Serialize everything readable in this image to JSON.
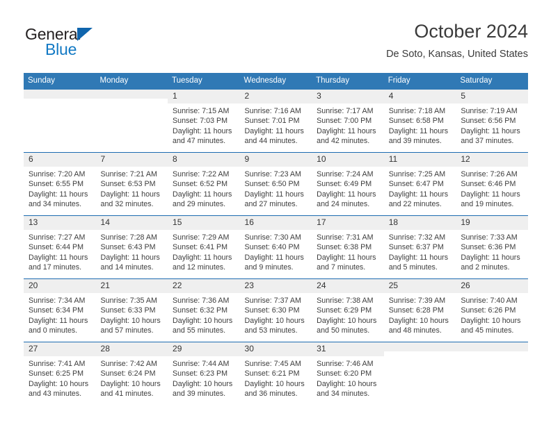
{
  "brand": {
    "name_part1": "General",
    "name_part2": "Blue",
    "triangle_color": "#1065ad",
    "blue_color": "#1279c4"
  },
  "header": {
    "title": "October 2024",
    "subtitle": "De Soto, Kansas, United States"
  },
  "theme": {
    "header_bg": "#3079b5",
    "row_divider": "#1c6bb0",
    "daynum_bg": "#efefef"
  },
  "weekday_headers": [
    "Sunday",
    "Monday",
    "Tuesday",
    "Wednesday",
    "Thursday",
    "Friday",
    "Saturday"
  ],
  "weeks": [
    [
      {
        "day": "",
        "sunrise": "",
        "sunset": "",
        "daylight_l1": "",
        "daylight_l2": ""
      },
      {
        "day": "",
        "sunrise": "",
        "sunset": "",
        "daylight_l1": "",
        "daylight_l2": ""
      },
      {
        "day": "1",
        "sunrise": "Sunrise: 7:15 AM",
        "sunset": "Sunset: 7:03 PM",
        "daylight_l1": "Daylight: 11 hours",
        "daylight_l2": "and 47 minutes."
      },
      {
        "day": "2",
        "sunrise": "Sunrise: 7:16 AM",
        "sunset": "Sunset: 7:01 PM",
        "daylight_l1": "Daylight: 11 hours",
        "daylight_l2": "and 44 minutes."
      },
      {
        "day": "3",
        "sunrise": "Sunrise: 7:17 AM",
        "sunset": "Sunset: 7:00 PM",
        "daylight_l1": "Daylight: 11 hours",
        "daylight_l2": "and 42 minutes."
      },
      {
        "day": "4",
        "sunrise": "Sunrise: 7:18 AM",
        "sunset": "Sunset: 6:58 PM",
        "daylight_l1": "Daylight: 11 hours",
        "daylight_l2": "and 39 minutes."
      },
      {
        "day": "5",
        "sunrise": "Sunrise: 7:19 AM",
        "sunset": "Sunset: 6:56 PM",
        "daylight_l1": "Daylight: 11 hours",
        "daylight_l2": "and 37 minutes."
      }
    ],
    [
      {
        "day": "6",
        "sunrise": "Sunrise: 7:20 AM",
        "sunset": "Sunset: 6:55 PM",
        "daylight_l1": "Daylight: 11 hours",
        "daylight_l2": "and 34 minutes."
      },
      {
        "day": "7",
        "sunrise": "Sunrise: 7:21 AM",
        "sunset": "Sunset: 6:53 PM",
        "daylight_l1": "Daylight: 11 hours",
        "daylight_l2": "and 32 minutes."
      },
      {
        "day": "8",
        "sunrise": "Sunrise: 7:22 AM",
        "sunset": "Sunset: 6:52 PM",
        "daylight_l1": "Daylight: 11 hours",
        "daylight_l2": "and 29 minutes."
      },
      {
        "day": "9",
        "sunrise": "Sunrise: 7:23 AM",
        "sunset": "Sunset: 6:50 PM",
        "daylight_l1": "Daylight: 11 hours",
        "daylight_l2": "and 27 minutes."
      },
      {
        "day": "10",
        "sunrise": "Sunrise: 7:24 AM",
        "sunset": "Sunset: 6:49 PM",
        "daylight_l1": "Daylight: 11 hours",
        "daylight_l2": "and 24 minutes."
      },
      {
        "day": "11",
        "sunrise": "Sunrise: 7:25 AM",
        "sunset": "Sunset: 6:47 PM",
        "daylight_l1": "Daylight: 11 hours",
        "daylight_l2": "and 22 minutes."
      },
      {
        "day": "12",
        "sunrise": "Sunrise: 7:26 AM",
        "sunset": "Sunset: 6:46 PM",
        "daylight_l1": "Daylight: 11 hours",
        "daylight_l2": "and 19 minutes."
      }
    ],
    [
      {
        "day": "13",
        "sunrise": "Sunrise: 7:27 AM",
        "sunset": "Sunset: 6:44 PM",
        "daylight_l1": "Daylight: 11 hours",
        "daylight_l2": "and 17 minutes."
      },
      {
        "day": "14",
        "sunrise": "Sunrise: 7:28 AM",
        "sunset": "Sunset: 6:43 PM",
        "daylight_l1": "Daylight: 11 hours",
        "daylight_l2": "and 14 minutes."
      },
      {
        "day": "15",
        "sunrise": "Sunrise: 7:29 AM",
        "sunset": "Sunset: 6:41 PM",
        "daylight_l1": "Daylight: 11 hours",
        "daylight_l2": "and 12 minutes."
      },
      {
        "day": "16",
        "sunrise": "Sunrise: 7:30 AM",
        "sunset": "Sunset: 6:40 PM",
        "daylight_l1": "Daylight: 11 hours",
        "daylight_l2": "and 9 minutes."
      },
      {
        "day": "17",
        "sunrise": "Sunrise: 7:31 AM",
        "sunset": "Sunset: 6:38 PM",
        "daylight_l1": "Daylight: 11 hours",
        "daylight_l2": "and 7 minutes."
      },
      {
        "day": "18",
        "sunrise": "Sunrise: 7:32 AM",
        "sunset": "Sunset: 6:37 PM",
        "daylight_l1": "Daylight: 11 hours",
        "daylight_l2": "and 5 minutes."
      },
      {
        "day": "19",
        "sunrise": "Sunrise: 7:33 AM",
        "sunset": "Sunset: 6:36 PM",
        "daylight_l1": "Daylight: 11 hours",
        "daylight_l2": "and 2 minutes."
      }
    ],
    [
      {
        "day": "20",
        "sunrise": "Sunrise: 7:34 AM",
        "sunset": "Sunset: 6:34 PM",
        "daylight_l1": "Daylight: 11 hours",
        "daylight_l2": "and 0 minutes."
      },
      {
        "day": "21",
        "sunrise": "Sunrise: 7:35 AM",
        "sunset": "Sunset: 6:33 PM",
        "daylight_l1": "Daylight: 10 hours",
        "daylight_l2": "and 57 minutes."
      },
      {
        "day": "22",
        "sunrise": "Sunrise: 7:36 AM",
        "sunset": "Sunset: 6:32 PM",
        "daylight_l1": "Daylight: 10 hours",
        "daylight_l2": "and 55 minutes."
      },
      {
        "day": "23",
        "sunrise": "Sunrise: 7:37 AM",
        "sunset": "Sunset: 6:30 PM",
        "daylight_l1": "Daylight: 10 hours",
        "daylight_l2": "and 53 minutes."
      },
      {
        "day": "24",
        "sunrise": "Sunrise: 7:38 AM",
        "sunset": "Sunset: 6:29 PM",
        "daylight_l1": "Daylight: 10 hours",
        "daylight_l2": "and 50 minutes."
      },
      {
        "day": "25",
        "sunrise": "Sunrise: 7:39 AM",
        "sunset": "Sunset: 6:28 PM",
        "daylight_l1": "Daylight: 10 hours",
        "daylight_l2": "and 48 minutes."
      },
      {
        "day": "26",
        "sunrise": "Sunrise: 7:40 AM",
        "sunset": "Sunset: 6:26 PM",
        "daylight_l1": "Daylight: 10 hours",
        "daylight_l2": "and 45 minutes."
      }
    ],
    [
      {
        "day": "27",
        "sunrise": "Sunrise: 7:41 AM",
        "sunset": "Sunset: 6:25 PM",
        "daylight_l1": "Daylight: 10 hours",
        "daylight_l2": "and 43 minutes."
      },
      {
        "day": "28",
        "sunrise": "Sunrise: 7:42 AM",
        "sunset": "Sunset: 6:24 PM",
        "daylight_l1": "Daylight: 10 hours",
        "daylight_l2": "and 41 minutes."
      },
      {
        "day": "29",
        "sunrise": "Sunrise: 7:44 AM",
        "sunset": "Sunset: 6:23 PM",
        "daylight_l1": "Daylight: 10 hours",
        "daylight_l2": "and 39 minutes."
      },
      {
        "day": "30",
        "sunrise": "Sunrise: 7:45 AM",
        "sunset": "Sunset: 6:21 PM",
        "daylight_l1": "Daylight: 10 hours",
        "daylight_l2": "and 36 minutes."
      },
      {
        "day": "31",
        "sunrise": "Sunrise: 7:46 AM",
        "sunset": "Sunset: 6:20 PM",
        "daylight_l1": "Daylight: 10 hours",
        "daylight_l2": "and 34 minutes."
      },
      {
        "day": "",
        "sunrise": "",
        "sunset": "",
        "daylight_l1": "",
        "daylight_l2": ""
      },
      {
        "day": "",
        "sunrise": "",
        "sunset": "",
        "daylight_l1": "",
        "daylight_l2": ""
      }
    ]
  ]
}
